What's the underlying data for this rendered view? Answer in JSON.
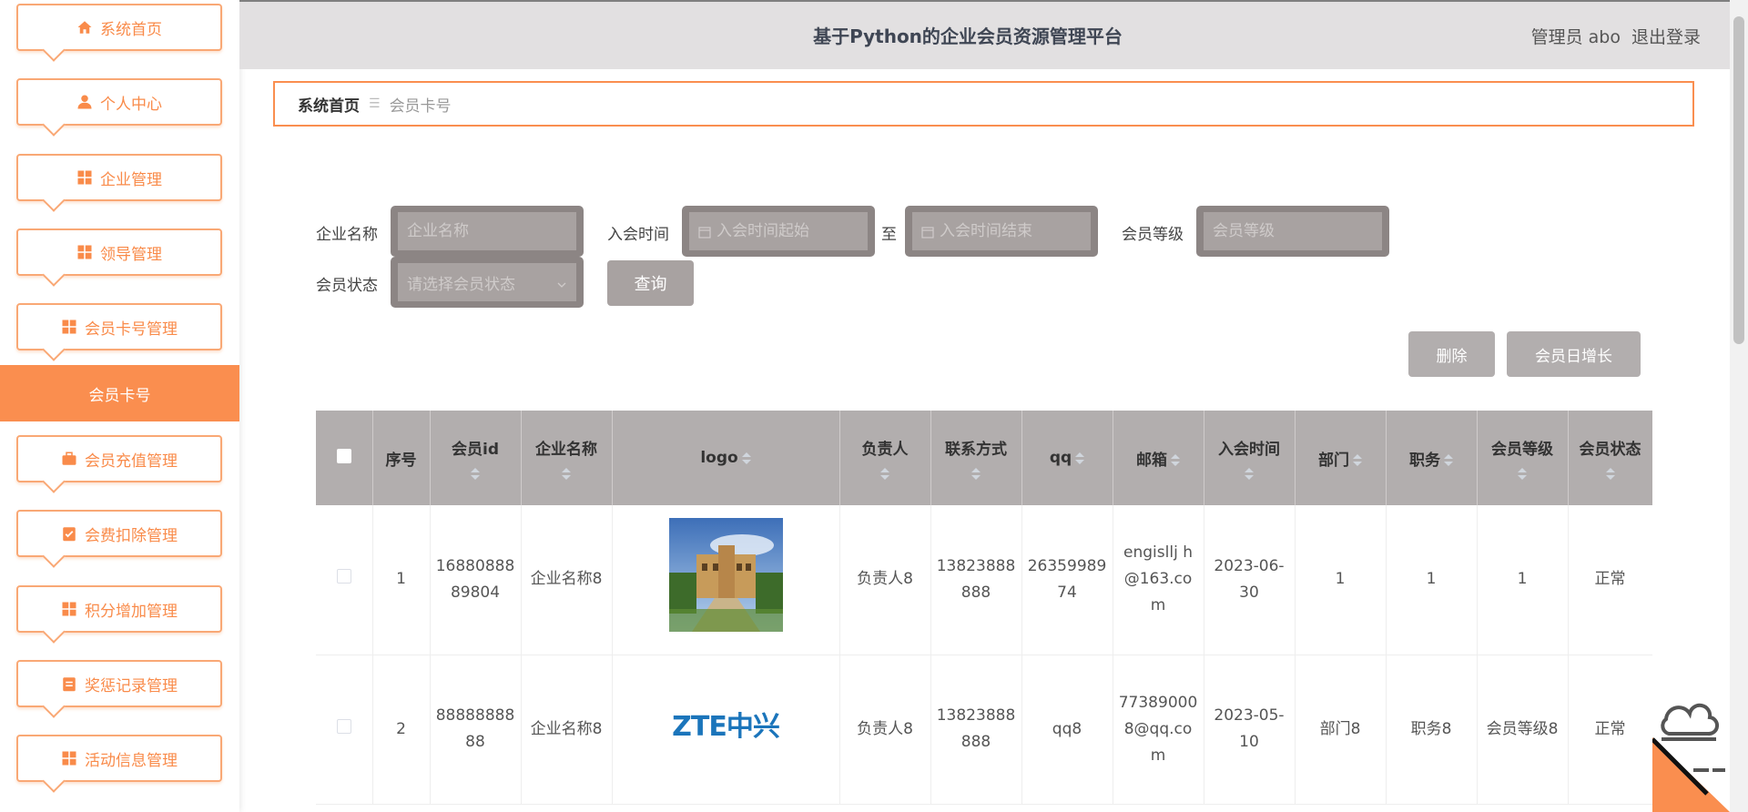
{
  "app": {
    "title": "基于Python的企业会员资源管理平台",
    "user_label": "管理员 abo",
    "logout_label": "退出登录"
  },
  "sidebar": {
    "items": [
      {
        "label": "系统首页",
        "icon": "home-icon"
      },
      {
        "label": "个人中心",
        "icon": "person-icon"
      },
      {
        "label": "企业管理",
        "icon": "grid-icon"
      },
      {
        "label": "领导管理",
        "icon": "grid-icon"
      },
      {
        "label": "会员卡号管理",
        "icon": "grid-icon"
      },
      {
        "label": "会员充值管理",
        "icon": "briefcase-icon"
      },
      {
        "label": "会费扣除管理",
        "icon": "clipboard-check-icon"
      },
      {
        "label": "积分增加管理",
        "icon": "grid-icon"
      },
      {
        "label": "奖惩记录管理",
        "icon": "clipboard-icon"
      },
      {
        "label": "活动信息管理",
        "icon": "grid-icon"
      }
    ],
    "active_sub": "会员卡号"
  },
  "breadcrumb": {
    "home": "系统首页",
    "current": "会员卡号"
  },
  "search": {
    "company_label": "企业名称",
    "company_placeholder": "企业名称",
    "join_time_label": "入会时间",
    "join_start_placeholder": "入会时间起始",
    "to_label": "至",
    "join_end_placeholder": "入会时间结束",
    "level_label": "会员等级",
    "level_placeholder": "会员等级",
    "status_label": "会员状态",
    "status_placeholder": "请选择会员状态",
    "query_button": "查询"
  },
  "actions": {
    "delete_button": "删除",
    "daily_growth_button": "会员日增长"
  },
  "table": {
    "headers": {
      "index": "序号",
      "member_id": "会员id",
      "company": "企业名称",
      "logo": "logo",
      "owner": "负责人",
      "contact": "联系方式",
      "qq": "qq",
      "email": "邮箱",
      "join_time": "入会时间",
      "department": "部门",
      "position": "职务",
      "level": "会员等级",
      "status": "会员状态"
    },
    "rows": [
      {
        "index": "1",
        "member_id": "1688088889804",
        "company": "企业名称8",
        "logo": "building-photo",
        "owner": "负责人8",
        "contact": "13823888888",
        "qq": "2635998974",
        "email": "engisllj h@163.com",
        "join_time": "2023-06-30",
        "department": "1",
        "position": "1",
        "level": "1",
        "status": "正常"
      },
      {
        "index": "2",
        "member_id": "8888888888",
        "company": "企业名称8",
        "logo": "ZTE中兴",
        "owner": "负责人8",
        "contact": "13823888888",
        "qq": "qq8",
        "email": "773890008@qq.com",
        "join_time": "2023-05-10",
        "department": "部门8",
        "position": "职务8",
        "level": "会员等级8",
        "status": "正常"
      }
    ]
  },
  "colors": {
    "accent": "#fa8e4f",
    "header_bg": "#e2e0e1",
    "table_head": "#b2aeae",
    "zte_blue": "#1b75bb"
  }
}
